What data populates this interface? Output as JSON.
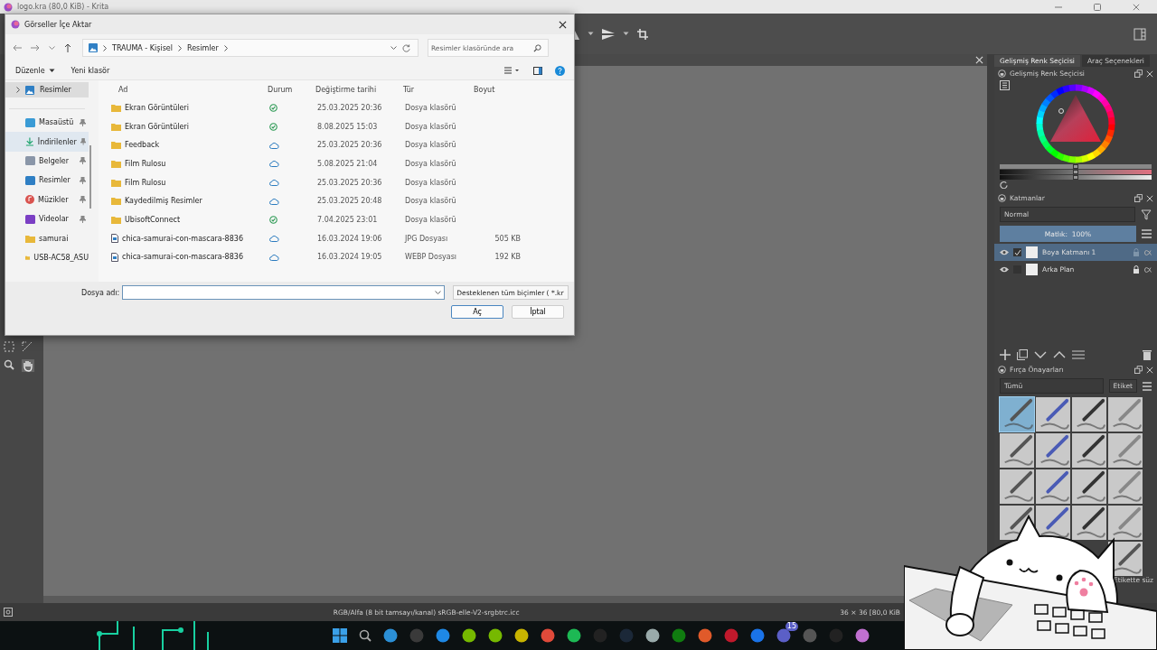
{
  "krita": {
    "title": "logo.kra (80,0 KiB)  - Krita"
  },
  "dialog": {
    "title": "Görseller İçe Aktar",
    "breadcrumb": [
      "TRAUMA - Kişisel",
      "Resimler"
    ],
    "search": {
      "placeholder": "Resimler klasöründe ara"
    },
    "commands": [
      "Düzenle",
      "Yeni klasör"
    ],
    "nav_root": {
      "label": "Resimler",
      "selected": true
    },
    "quick_access": [
      {
        "label": "Masaüstü",
        "kind": "desktop",
        "pinned": true,
        "selected": false
      },
      {
        "label": "İndirilenler",
        "kind": "downloads",
        "pinned": true,
        "selected": true
      },
      {
        "label": "Belgeler",
        "kind": "documents",
        "pinned": true,
        "selected": false
      },
      {
        "label": "Resimler",
        "kind": "pictures",
        "pinned": true,
        "selected": false
      },
      {
        "label": "Müzikler",
        "kind": "music",
        "pinned": true,
        "selected": false
      },
      {
        "label": "Videolar",
        "kind": "videos",
        "pinned": true,
        "selected": false
      },
      {
        "label": "samurai",
        "kind": "folder",
        "pinned": false,
        "selected": false
      },
      {
        "label": "USB-AC58_ASU",
        "kind": "folder",
        "pinned": false,
        "selected": false
      }
    ],
    "columns": [
      "Ad",
      "Durum",
      "Değiştirme tarihi",
      "Tür",
      "Boyut"
    ],
    "rows": [
      {
        "name": "Ekran Görüntüleri",
        "kind": "folder",
        "synced": true,
        "modified": "25.03.2025 20:36",
        "type": "Dosya klasörü"
      },
      {
        "name": "Ekran Görüntüleri",
        "kind": "folder",
        "synced": true,
        "modified": "8.08.2025 15:03",
        "type": "Dosya klasörü"
      },
      {
        "name": "Feedback",
        "kind": "folder",
        "synced": false,
        "modified": "25.03.2025 20:36",
        "type": "Dosya klasörü"
      },
      {
        "name": "Film Rulosu",
        "kind": "folder",
        "synced": false,
        "modified": "5.08.2025 21:04",
        "type": "Dosya klasörü"
      },
      {
        "name": "Film Rulosu",
        "kind": "folder",
        "synced": false,
        "modified": "25.03.2025 20:36",
        "type": "Dosya klasörü"
      },
      {
        "name": "Kaydedilmiş Resimler",
        "kind": "folder",
        "synced": false,
        "modified": "25.03.2025 20:48",
        "type": "Dosya klasörü"
      },
      {
        "name": "UbisoftConnect",
        "kind": "folder",
        "synced": true,
        "modified": "7.04.2025 23:01",
        "type": "Dosya klasörü"
      },
      {
        "name": "chica-samurai-con-mascara-8836",
        "kind": "file",
        "synced": false,
        "modified": "16.03.2024 19:06",
        "type": "JPG Dosyası",
        "size": "505 KB"
      },
      {
        "name": "chica-samurai-con-mascara-8836",
        "kind": "file",
        "synced": false,
        "modified": "16.03.2024 19:05",
        "type": "WEBP Dosyası",
        "size": "192 KB"
      }
    ],
    "filename_label": "Dosya adı:",
    "filter": "Desteklenen tüm biçimler ( *.kr",
    "buttons": [
      {
        "label": "Aç",
        "default": true
      },
      {
        "label": "İptal",
        "default": false
      }
    ]
  },
  "dockers": {
    "tabs": [
      {
        "label": "Gelişmiş Renk Seçicisi",
        "selected": true
      },
      {
        "label": "Araç Seçenekleri",
        "selected": false
      }
    ],
    "color_selector": {
      "title": "Gelişmiş Renk Seçicisi",
      "sliders": [
        {
          "level": 0.5
        },
        {
          "level": 0.5
        },
        {
          "level": 0.5
        }
      ]
    },
    "layers": {
      "title": "Katmanlar",
      "blend_mode": "Normal",
      "opacity": {
        "label": "Matlık:  100%",
        "level": 1
      },
      "items": [
        {
          "name": "Boya Katmanı 1",
          "selected": true,
          "checked": true,
          "locked": false
        },
        {
          "name": "Arka Plan",
          "selected": false,
          "checked": false,
          "locked": true
        }
      ]
    },
    "brushes": {
      "title": "Fırça Önayarları",
      "tag_filter": "Tümü",
      "tag_button": "Etiket",
      "filter_field": {
        "placeholder": "Etikette süz"
      },
      "presets": [
        {
          "selected": true
        },
        {
          "selected": false
        },
        {
          "selected": false
        },
        {
          "selected": false
        },
        {
          "selected": false
        },
        {
          "selected": false
        },
        {
          "selected": false
        },
        {
          "selected": false
        },
        {
          "selected": false
        },
        {
          "selected": false
        },
        {
          "selected": false
        },
        {
          "selected": false
        },
        {
          "selected": false
        },
        {
          "selected": false
        },
        {
          "selected": false
        },
        {
          "selected": false
        },
        {
          "selected": false
        }
      ]
    }
  },
  "status_bar": {
    "color_profile": "RGB/Alfa (8 bit tamsayı/kanal) sRGB-elle-V2-srgbtrc.icc",
    "size": "36 × 36 [80,0 KiB"
  },
  "taskbar": {
    "badge": "15"
  }
}
